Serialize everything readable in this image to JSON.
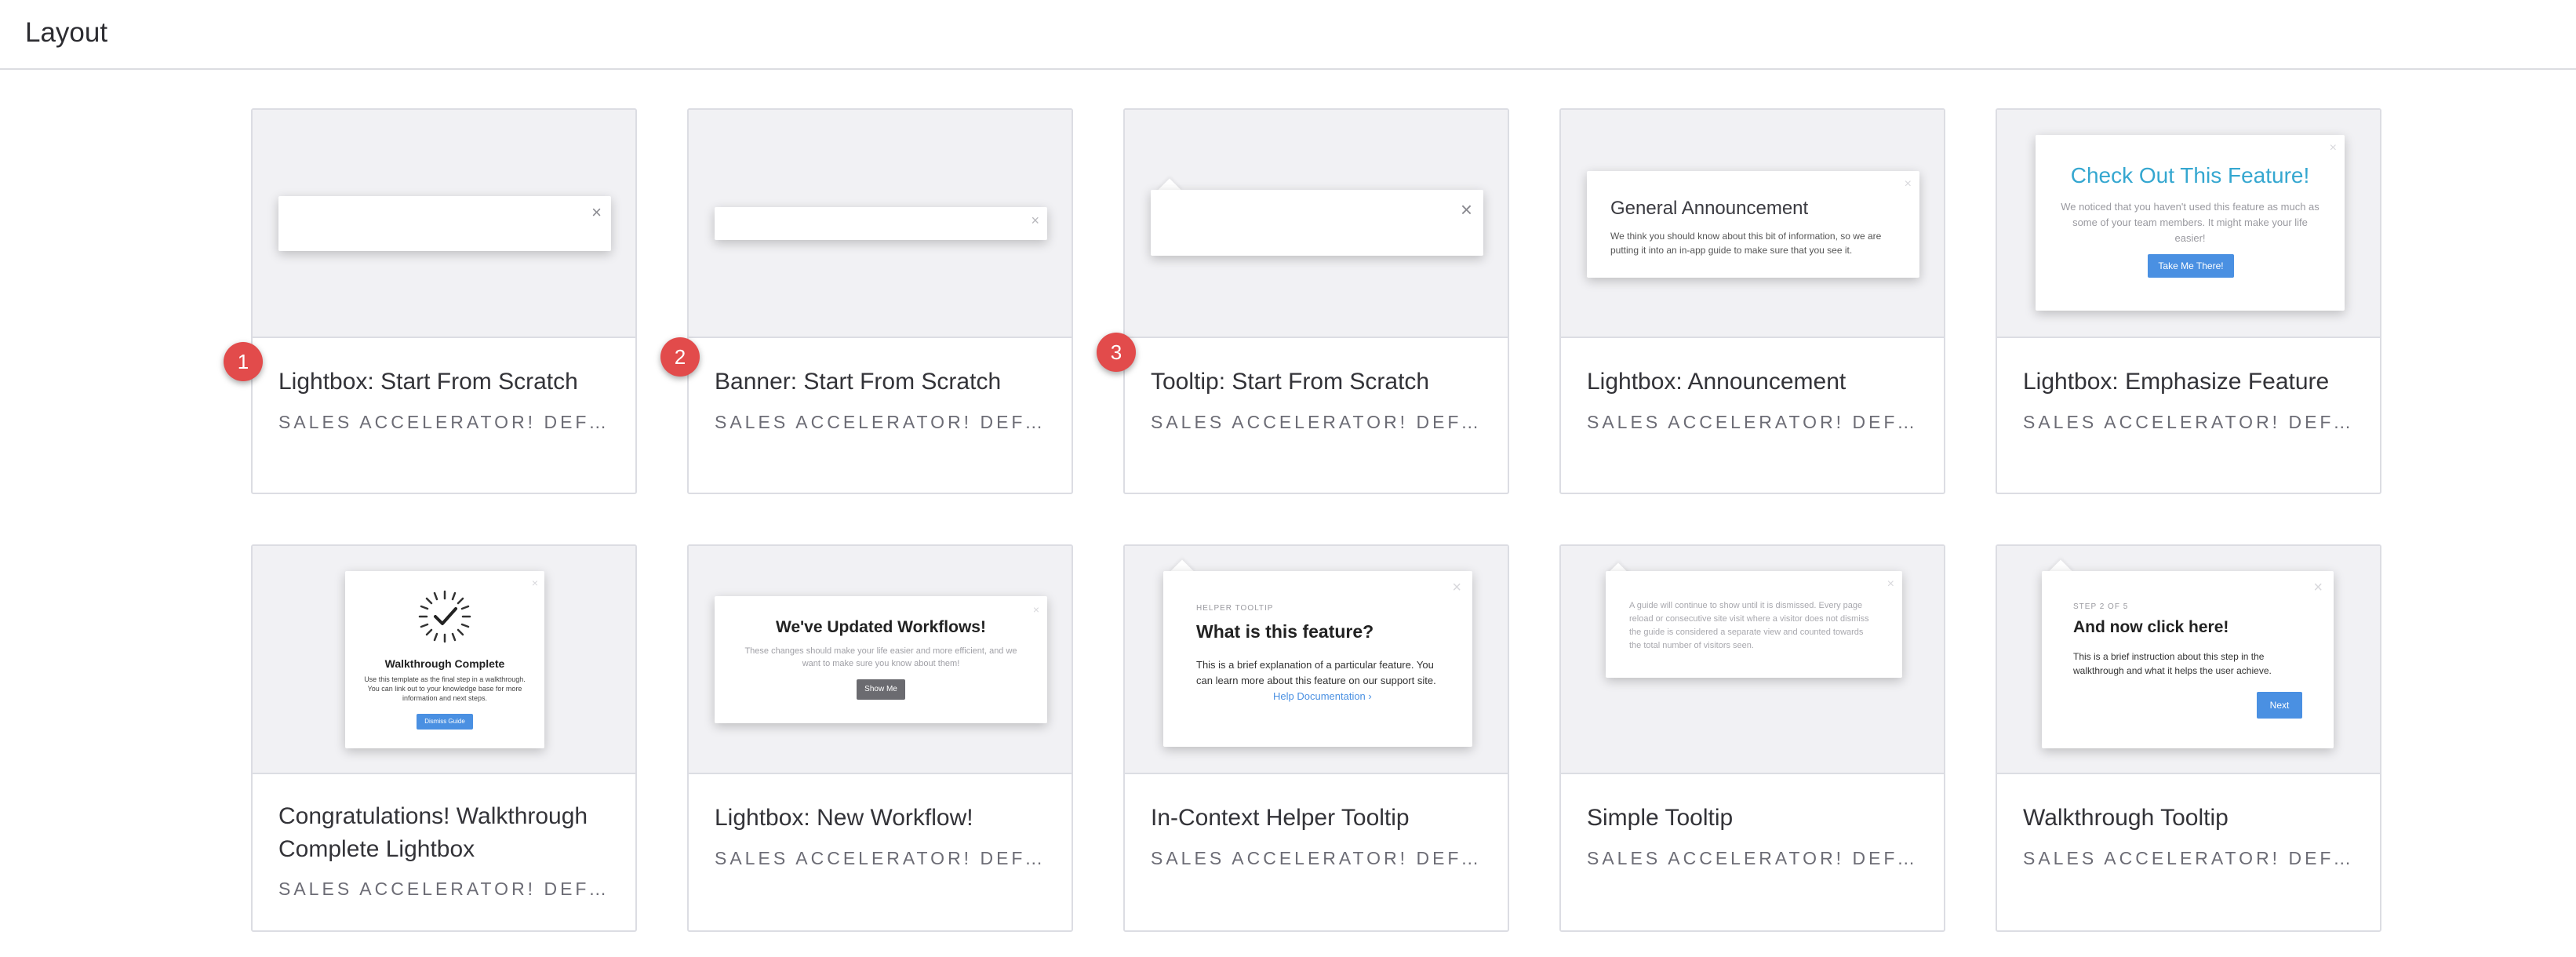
{
  "header": {
    "title": "Layout"
  },
  "colors": {
    "badge": "#e24b4b",
    "accent_blue": "#4a90e2",
    "teal_heading": "#35a7d0"
  },
  "cards": [
    {
      "title": "Lightbox: Start From Scratch",
      "subtitle": "SALES ACCELERATOR! DEFAULT",
      "badge": "1"
    },
    {
      "title": "Banner: Start From Scratch",
      "subtitle": "SALES ACCELERATOR! DEFAULT",
      "badge": "2"
    },
    {
      "title": "Tooltip: Start From Scratch",
      "subtitle": "SALES ACCELERATOR! DEFAULT",
      "badge": "3"
    },
    {
      "title": "Lightbox: Announcement",
      "subtitle": "SALES ACCELERATOR! DEFAULT",
      "preview": {
        "heading": "General Announcement",
        "body": "We think you should know about this bit of information, so we are putting it into an in-app guide to make sure that you see it."
      }
    },
    {
      "title": "Lightbox: Emphasize Feature",
      "subtitle": "SALES ACCELERATOR! DEFAULT",
      "preview": {
        "heading": "Check Out This Feature!",
        "body": "We noticed that you haven't used this feature as much as some of your team members. It might make your life easier!",
        "button": "Take Me There!"
      }
    },
    {
      "title": "Congratulations! Walkthrough Complete Lightbox",
      "subtitle": "SALES ACCELERATOR! DEFAULT",
      "preview": {
        "heading": "Walkthrough Complete",
        "body": "Use this template as the final step in a walkthrough. You can link out to your knowledge base for more information and next steps.",
        "button": "Dismiss Guide"
      }
    },
    {
      "title": "Lightbox: New Workflow!",
      "subtitle": "SALES ACCELERATOR! DEFAULT",
      "preview": {
        "heading": "We've Updated Workflows!",
        "body": "These changes should make your life easier and more efficient, and we want to make sure you know about them!",
        "button": "Show Me"
      }
    },
    {
      "title": "In-Context Helper Tooltip",
      "subtitle": "SALES ACCELERATOR! DEFAULT",
      "preview": {
        "eyebrow": "HELPER TOOLTIP",
        "heading": "What is this feature?",
        "body": "This is a brief explanation of a particular feature. You can learn more about this feature on our support site.",
        "link": "Help Documentation ›"
      }
    },
    {
      "title": "Simple Tooltip",
      "subtitle": "SALES ACCELERATOR! DEFAULT",
      "preview": {
        "body": "A guide will continue to show until it is dismissed. Every page reload or consecutive site visit where a visitor does not dismiss the guide is considered a separate view and counted towards the total number of visitors seen."
      }
    },
    {
      "title": "Walkthrough Tooltip",
      "subtitle": "SALES ACCELERATOR! DEFAULT",
      "preview": {
        "eyebrow": "STEP 2 OF 5",
        "heading": "And now click here!",
        "body": "This is a brief instruction about this step in the walkthrough and what it helps the user achieve.",
        "button": "Next"
      }
    }
  ]
}
